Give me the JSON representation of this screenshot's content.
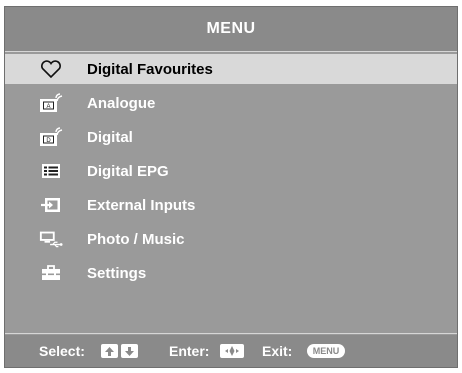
{
  "header": {
    "title": "MENU"
  },
  "menu": {
    "items": [
      {
        "label": "Digital Favourites",
        "icon": "heart-icon",
        "selected": true
      },
      {
        "label": "Analogue",
        "icon": "analogue-tv-icon",
        "selected": false
      },
      {
        "label": "Digital",
        "icon": "digital-tv-icon",
        "selected": false
      },
      {
        "label": "Digital EPG",
        "icon": "epg-guide-icon",
        "selected": false
      },
      {
        "label": "External Inputs",
        "icon": "external-input-icon",
        "selected": false
      },
      {
        "label": "Photo / Music",
        "icon": "usb-device-icon",
        "selected": false
      },
      {
        "label": "Settings",
        "icon": "toolbox-icon",
        "selected": false
      }
    ]
  },
  "footer": {
    "select_label": "Select:",
    "enter_label": "Enter:",
    "exit_label": "Exit:",
    "exit_key": "MENU"
  },
  "colors": {
    "panel": "#9a9a9a",
    "bar": "#8a8a8a",
    "selected": "#d9d9d9",
    "text": "#ffffff"
  }
}
